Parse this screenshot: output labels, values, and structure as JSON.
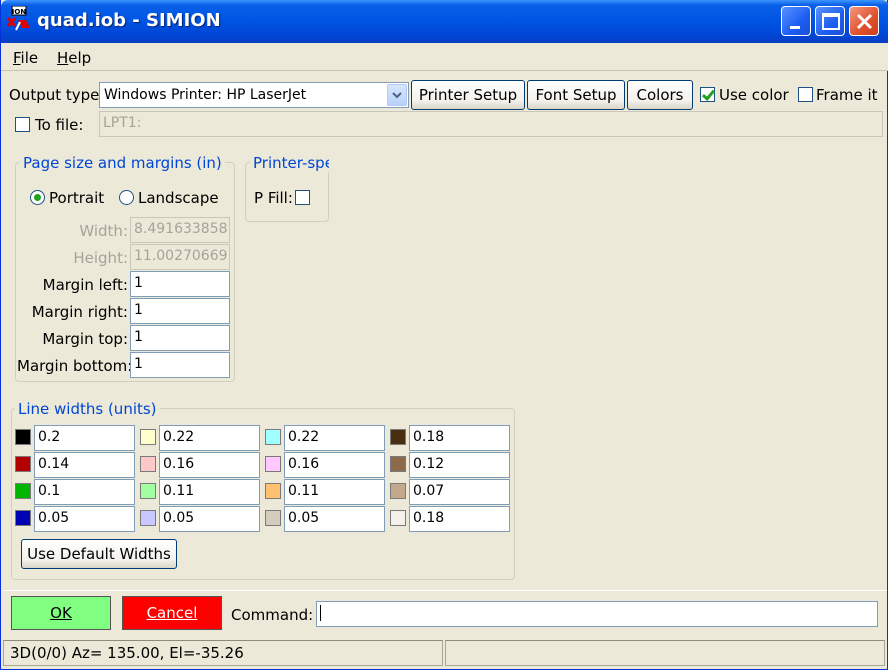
{
  "window": {
    "title": "quad.iob - SIMION",
    "icon_text": "ION"
  },
  "menu": [
    {
      "label": "File",
      "accel": "F",
      "rest": "ile"
    },
    {
      "label": "Help",
      "accel": "H",
      "rest": "elp"
    }
  ],
  "output": {
    "type_label": "Output type:",
    "type_value": "Windows Printer: HP LaserJet",
    "printer_setup": "Printer Setup",
    "font_setup": "Font Setup",
    "colors": "Colors",
    "use_color": "Use color",
    "use_color_checked": true,
    "frame_it": "Frame it",
    "frame_it_checked": false,
    "to_file": "To file:",
    "to_file_checked": false,
    "file_value": "LPT1:"
  },
  "page": {
    "title": "Page size and margins (in)",
    "portrait": "Portrait",
    "landscape": "Landscape",
    "orientation": "Portrait",
    "width_label": "Width:",
    "width_value": "8.491633858",
    "height_label": "Height:",
    "height_value": "11.00270669",
    "margin_left_label": "Margin left:",
    "margin_left": "1",
    "margin_right_label": "Margin right:",
    "margin_right": "1",
    "margin_top_label": "Margin top:",
    "margin_top": "1",
    "margin_bottom_label": "Margin bottom:",
    "margin_bottom": "1"
  },
  "printer_specific": {
    "title": "Printer-spe",
    "p_fill": "P Fill:",
    "p_fill_checked": false
  },
  "line_widths": {
    "title": "Line widths (units)",
    "default_button": "Use Default Widths",
    "columns": [
      [
        {
          "color": "#000000",
          "value": "0.2"
        },
        {
          "color": "#b40000",
          "value": "0.14"
        },
        {
          "color": "#00b400",
          "value": "0.1"
        },
        {
          "color": "#0000b4",
          "value": "0.05"
        }
      ],
      [
        {
          "color": "#ffffcc",
          "value": "0.22"
        },
        {
          "color": "#ffc8c8",
          "value": "0.16"
        },
        {
          "color": "#a0ffa0",
          "value": "0.11"
        },
        {
          "color": "#c8c8ff",
          "value": "0.05"
        }
      ],
      [
        {
          "color": "#a0ffff",
          "value": "0.22"
        },
        {
          "color": "#ffc8ff",
          "value": "0.16"
        },
        {
          "color": "#ffc070",
          "value": "0.11"
        },
        {
          "color": "#d6ccbe",
          "value": "0.05"
        }
      ],
      [
        {
          "color": "#4a2e10",
          "value": "0.18"
        },
        {
          "color": "#8c6a4c",
          "value": "0.12"
        },
        {
          "color": "#c4a88c",
          "value": "0.07"
        },
        {
          "color": "#f4f0ec",
          "value": "0.18"
        }
      ]
    ]
  },
  "bottom": {
    "ok": "OK",
    "cancel": "Cancel",
    "command_label": "Command:",
    "command_value": ""
  },
  "status": {
    "text": "3D(0/0) Az= 135.00, El=-35.26"
  }
}
